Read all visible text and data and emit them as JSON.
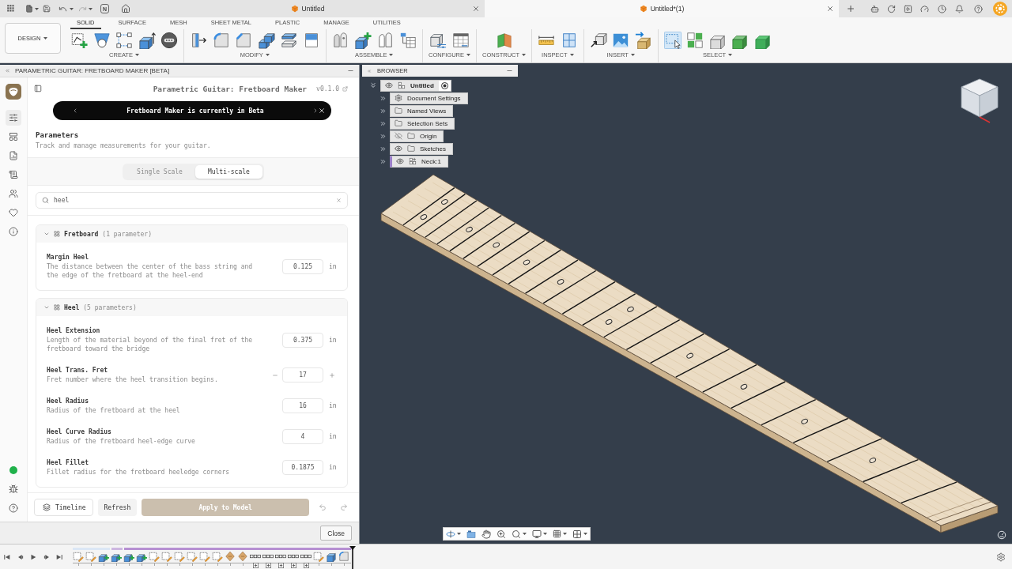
{
  "app_bar": {
    "badge": "N",
    "undo": {
      "disabled": false
    },
    "redo": {
      "disabled": true
    },
    "tabs": [
      {
        "title": "Untitled",
        "selected": false
      },
      {
        "title": "Untitled*(1)",
        "selected": true
      }
    ]
  },
  "toolbar": {
    "workspace": "DESIGN",
    "tabs": [
      {
        "label": "SOLID",
        "selected": true
      },
      {
        "label": "SURFACE",
        "selected": false
      },
      {
        "label": "MESH",
        "selected": false
      },
      {
        "label": "SHEET METAL",
        "selected": false
      },
      {
        "label": "PLASTIC",
        "selected": false
      },
      {
        "label": "MANAGE",
        "selected": false
      },
      {
        "label": "UTILITIES",
        "selected": false
      }
    ],
    "groups": [
      {
        "label": "CREATE",
        "tools": [
          {
            "kind": "sketch"
          },
          {
            "kind": "hole"
          },
          {
            "kind": "nodes"
          },
          {
            "kind": "extrude"
          },
          {
            "kind": "emboss"
          }
        ]
      },
      {
        "label": "MODIFY",
        "tools": [
          {
            "kind": "presspull"
          },
          {
            "kind": "fillet"
          },
          {
            "kind": "chamfer"
          },
          {
            "kind": "combine"
          },
          {
            "kind": "split"
          },
          {
            "kind": "panel"
          }
        ]
      },
      {
        "label": "ASSEMBLE",
        "tools": [
          {
            "kind": "joint"
          },
          {
            "kind": "component"
          },
          {
            "kind": "rigid"
          },
          {
            "kind": "tree"
          }
        ]
      },
      {
        "label": "CONFIGURE",
        "tools": [
          {
            "kind": "configure"
          },
          {
            "kind": "grid"
          }
        ]
      },
      {
        "label": "CONSTRUCT",
        "tools": [
          {
            "kind": "plane"
          }
        ]
      },
      {
        "label": "INSPECT",
        "tools": [
          {
            "kind": "measure"
          },
          {
            "kind": "section"
          }
        ]
      },
      {
        "label": "INSERT",
        "tools": [
          {
            "kind": "derive"
          },
          {
            "kind": "image"
          },
          {
            "kind": "package"
          }
        ]
      },
      {
        "label": "SELECT",
        "tools": [
          {
            "kind": "window",
            "selected": true
          },
          {
            "kind": "filter",
            "selected": false
          },
          {
            "kind": "outline",
            "selected": false
          },
          {
            "kind": "body",
            "selected": false
          },
          {
            "kind": "solid",
            "selected": false
          }
        ]
      }
    ]
  },
  "palette": {
    "title": "PARAMETRIC GUITAR: FRETBOARD MAKER [BETA]",
    "rail": [
      {
        "kind": "sliders",
        "selected": true
      },
      {
        "kind": "layout",
        "selected": false
      },
      {
        "kind": "report",
        "selected": false
      },
      {
        "kind": "scroll",
        "selected": false
      },
      {
        "kind": "users",
        "selected": false
      },
      {
        "kind": "heart",
        "selected": false
      },
      {
        "kind": "info",
        "selected": false
      }
    ],
    "status": {
      "online": true
    },
    "header": {
      "title": "Parametric Guitar: Fretboard Maker",
      "version": "v0.1.0"
    },
    "banner": "Fretboard Maker is currently in Beta",
    "section": {
      "title": "Parameters",
      "subtitle": "Track and manage measurements for your guitar."
    },
    "scale_modes": [
      {
        "label": "Single Scale",
        "selected": false
      },
      {
        "label": "Multi-scale",
        "selected": true
      }
    ],
    "search": {
      "value": "heel"
    },
    "groups": [
      {
        "name": "Fretboard",
        "count": "(1 parameter)",
        "expanded": true,
        "params": [
          {
            "kind": "number",
            "name": "Margin Heel",
            "description": "The distance between the center of the bass string and the edge of the fretboard at the heel-end",
            "value": "0.125",
            "unit": "in"
          }
        ]
      },
      {
        "name": "Heel",
        "count": "(5 parameters)",
        "expanded": true,
        "params": [
          {
            "kind": "number",
            "name": "Heel Extension",
            "description": "Length of the material beyond of the final fret of the fretboard toward the bridge",
            "value": "0.375",
            "unit": "in"
          },
          {
            "kind": "stepper",
            "name": "Heel Trans. Fret",
            "description": "Fret number where the heel transition begins.",
            "value": "17"
          },
          {
            "kind": "number",
            "name": "Heel Radius",
            "description": "Radius of the fretboard at the heel",
            "value": "16",
            "unit": "in"
          },
          {
            "kind": "number",
            "name": "Heel Curve Radius",
            "description": "Radius of the fretboard heel-edge curve",
            "value": "4",
            "unit": "in"
          },
          {
            "kind": "number",
            "name": "Heel Fillet",
            "description": "Fillet radius for the fretboard heeledge corners",
            "value": "0.1875",
            "unit": "in"
          }
        ]
      }
    ],
    "footer": {
      "timeline": "Timeline",
      "refresh": "Refresh",
      "apply": {
        "label": "Apply to Model",
        "disabled": true
      }
    },
    "close": "Close"
  },
  "browser": {
    "title": "BROWSER",
    "tree": [
      {
        "label": "Untitled",
        "kind": "document",
        "visible": true,
        "active": true,
        "expanded": true,
        "children": [
          {
            "label": "Document Settings",
            "kind": "settings",
            "active": false,
            "expanded": false
          },
          {
            "label": "Named Views",
            "kind": "folder",
            "active": false,
            "expanded": false
          },
          {
            "label": "Selection Sets",
            "kind": "folder",
            "active": false,
            "expanded": false
          },
          {
            "label": "Origin",
            "kind": "folder",
            "visible": false,
            "active": false,
            "expanded": false
          },
          {
            "label": "Sketches",
            "kind": "folder",
            "visible": true,
            "active": false,
            "expanded": false
          },
          {
            "label": "Neck:1",
            "kind": "component",
            "visible": true,
            "active": false,
            "expanded": false
          }
        ]
      }
    ]
  },
  "timeline": {
    "features": [
      {
        "kind": "sketch"
      },
      {
        "kind": "sketch"
      },
      {
        "kind": "extrude"
      },
      {
        "kind": "extrude"
      },
      {
        "kind": "extrude"
      },
      {
        "kind": "extrude"
      },
      {
        "kind": "sketch"
      },
      {
        "kind": "sketch"
      },
      {
        "kind": "sketch"
      },
      {
        "kind": "sketch"
      },
      {
        "kind": "sketch"
      },
      {
        "kind": "sketch"
      },
      {
        "kind": "material"
      },
      {
        "kind": "material"
      },
      {
        "kind": "pattern"
      },
      {
        "kind": "pattern"
      },
      {
        "kind": "pattern"
      },
      {
        "kind": "pattern"
      },
      {
        "kind": "pattern"
      },
      {
        "kind": "sketch"
      },
      {
        "kind": "body"
      },
      {
        "kind": "fillet"
      }
    ]
  }
}
